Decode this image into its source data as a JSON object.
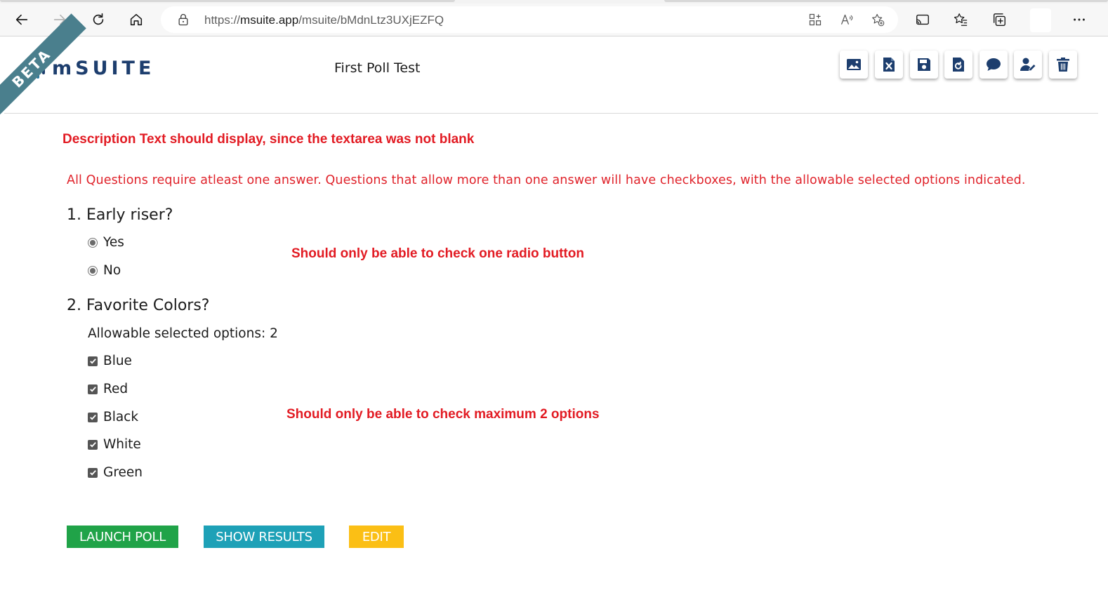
{
  "browser": {
    "url_prefix": "https://",
    "url_domain": "msuite.app",
    "url_path": "/msuite/bMdnLtz3UXjEZFQ"
  },
  "header": {
    "beta_label": "BETA",
    "logo_text": "mSUITE",
    "poll_title": "First Poll Test",
    "actions": [
      "image-icon",
      "excel-export-icon",
      "save-icon",
      "reset-icon",
      "comment-icon",
      "user-edit-icon",
      "trash-icon"
    ]
  },
  "content": {
    "description_note": "Description Text should display, since the textarea was not blank",
    "instructions": "All Questions require atleast one answer. Questions that allow more than one answer will have checkboxes, with the allowable selected options indicated.",
    "question1": {
      "title": "1. Early riser?",
      "options": [
        "Yes",
        "No"
      ]
    },
    "question2": {
      "title": "2. Favorite Colors?",
      "allowable": "Allowable selected options: 2",
      "options": [
        "Blue",
        "Red",
        "Black",
        "White",
        "Green"
      ]
    },
    "radio_note": "Should only be able to check one radio button",
    "checkbox_note": "Should only be able to check maximum 2 options"
  },
  "buttons": {
    "launch": "LAUNCH POLL",
    "results": "SHOW RESULTS",
    "edit": "EDIT"
  },
  "colors": {
    "accent_red": "#e21b23",
    "launch_green": "#20a348",
    "results_teal": "#1ea1b7",
    "edit_yellow": "#fbbf15",
    "logo_navy": "#1d3e6e"
  }
}
